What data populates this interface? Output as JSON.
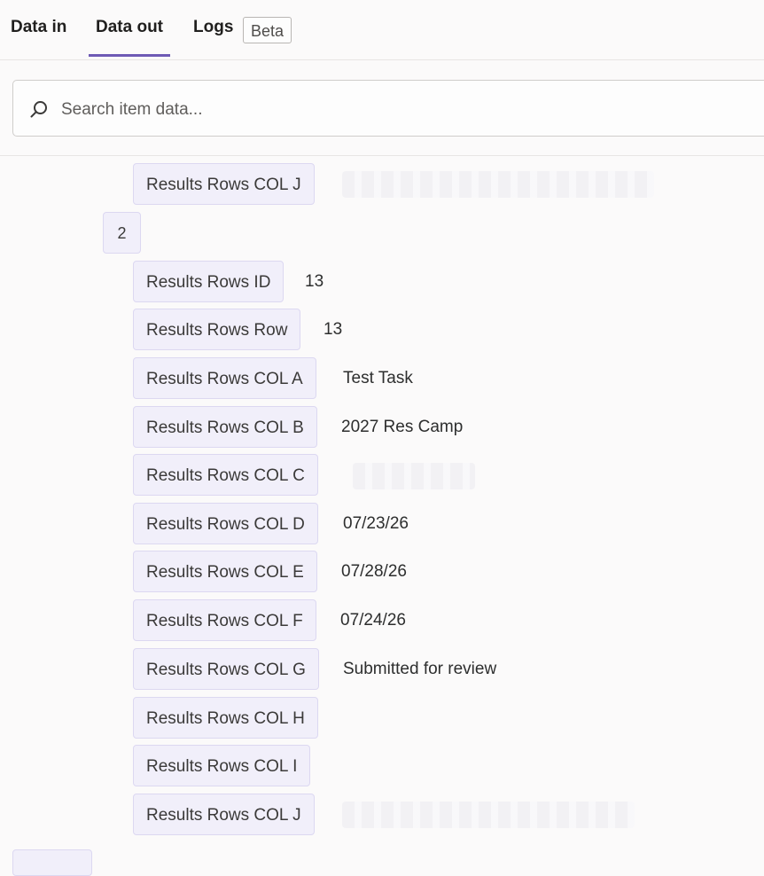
{
  "tabs": {
    "data_in": "Data in",
    "data_out": "Data out",
    "logs": "Logs",
    "beta_badge": "Beta"
  },
  "search": {
    "placeholder": "Search item data..."
  },
  "fields": {
    "top_col_j": {
      "label": "Results Rows COL J"
    },
    "index": "2",
    "id": {
      "label": "Results Rows ID",
      "value": "13"
    },
    "row": {
      "label": "Results Rows Row",
      "value": "13"
    },
    "col_a": {
      "label": "Results Rows COL A",
      "value": "Test Task"
    },
    "col_b": {
      "label": "Results Rows COL B",
      "value": "2027 Res Camp"
    },
    "col_c": {
      "label": "Results Rows COL C"
    },
    "col_d": {
      "label": "Results Rows COL D",
      "value": "07/23/26"
    },
    "col_e": {
      "label": "Results Rows COL E",
      "value": "07/28/26"
    },
    "col_f": {
      "label": "Results Rows COL F",
      "value": "07/24/26"
    },
    "col_g": {
      "label": "Results Rows COL G",
      "value": "Submitted for review"
    },
    "col_h": {
      "label": "Results Rows COL H"
    },
    "col_i": {
      "label": "Results Rows COL I"
    },
    "col_j": {
      "label": "Results Rows COL J"
    }
  },
  "icons": {
    "search": "search-icon"
  },
  "colors": {
    "accent": "#6e5ab5",
    "pill_bg": "#f1effa",
    "pill_border": "#dcd8f1"
  }
}
